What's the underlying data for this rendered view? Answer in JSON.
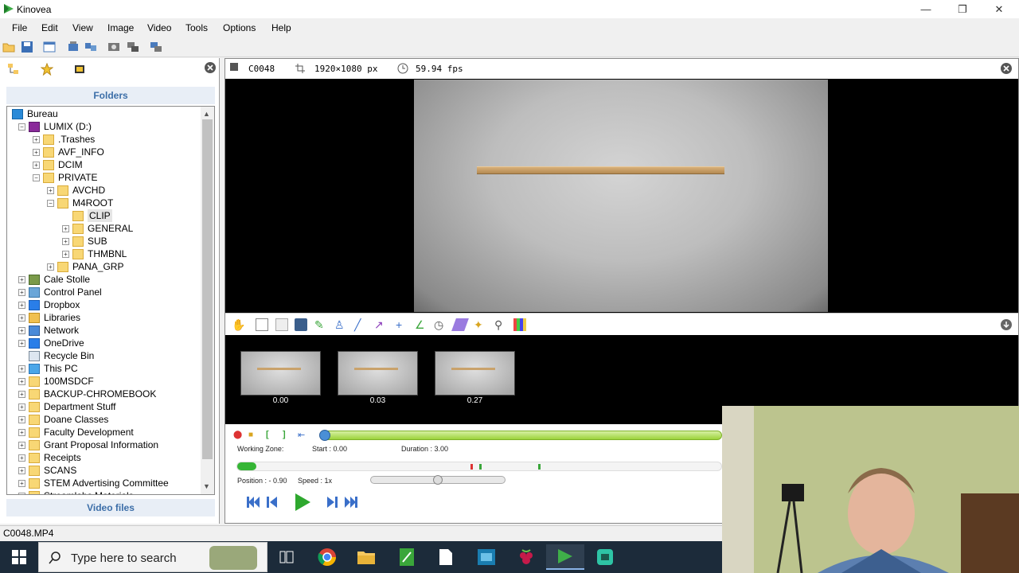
{
  "window": {
    "title": "Kinovea",
    "controls": [
      "—",
      "❐",
      "✕"
    ]
  },
  "menu": [
    "File",
    "Edit",
    "View",
    "Image",
    "Video",
    "Tools",
    "Options",
    "Help"
  ],
  "left_panel": {
    "folders_label": "Folders",
    "video_files_label": "Video files",
    "tree": [
      {
        "label": "Bureau",
        "level": 0,
        "icon": "desktop-icon",
        "exp": ""
      },
      {
        "label": "LUMIX (D:)",
        "level": 1,
        "icon": "sd-card-icon",
        "exp": "−"
      },
      {
        "label": ".Trashes",
        "level": 2,
        "icon": "folder-icon",
        "exp": "+"
      },
      {
        "label": "AVF_INFO",
        "level": 2,
        "icon": "folder-icon",
        "exp": "+"
      },
      {
        "label": "DCIM",
        "level": 2,
        "icon": "folder-icon",
        "exp": "+"
      },
      {
        "label": "PRIVATE",
        "level": 2,
        "icon": "folder-icon",
        "exp": "−"
      },
      {
        "label": "AVCHD",
        "level": 3,
        "icon": "folder-icon",
        "exp": "+"
      },
      {
        "label": "M4ROOT",
        "level": 3,
        "icon": "folder-icon",
        "exp": "−"
      },
      {
        "label": "CLIP",
        "level": 4,
        "icon": "folder-icon",
        "exp": "",
        "selected": true
      },
      {
        "label": "GENERAL",
        "level": 4,
        "icon": "folder-icon",
        "exp": "+"
      },
      {
        "label": "SUB",
        "level": 4,
        "icon": "folder-icon",
        "exp": "+"
      },
      {
        "label": "THMBNL",
        "level": 4,
        "icon": "folder-icon",
        "exp": "+"
      },
      {
        "label": "PANA_GRP",
        "level": 3,
        "icon": "folder-icon",
        "exp": "+"
      },
      {
        "label": "Cale Stolle",
        "level": 1,
        "icon": "user-icon",
        "exp": "+"
      },
      {
        "label": "Control Panel",
        "level": 1,
        "icon": "control-panel-icon",
        "exp": "+"
      },
      {
        "label": "Dropbox",
        "level": 1,
        "icon": "dropbox-icon",
        "exp": "+"
      },
      {
        "label": "Libraries",
        "level": 1,
        "icon": "library-icon",
        "exp": "+"
      },
      {
        "label": "Network",
        "level": 1,
        "icon": "network-icon",
        "exp": "+"
      },
      {
        "label": "OneDrive",
        "level": 1,
        "icon": "onedrive-icon",
        "exp": "+"
      },
      {
        "label": "Recycle Bin",
        "level": 1,
        "icon": "recycle-bin-icon",
        "exp": ""
      },
      {
        "label": "This PC",
        "level": 1,
        "icon": "computer-icon",
        "exp": "+"
      },
      {
        "label": "100MSDCF",
        "level": 1,
        "icon": "folder-icon",
        "exp": "+"
      },
      {
        "label": "BACKUP-CHROMEBOOK",
        "level": 1,
        "icon": "folder-icon",
        "exp": "+"
      },
      {
        "label": "Department Stuff",
        "level": 1,
        "icon": "folder-icon",
        "exp": "+"
      },
      {
        "label": "Doane Classes",
        "level": 1,
        "icon": "folder-icon",
        "exp": "+"
      },
      {
        "label": "Faculty Development",
        "level": 1,
        "icon": "folder-icon",
        "exp": "+"
      },
      {
        "label": "Grant Proposal Information",
        "level": 1,
        "icon": "folder-icon",
        "exp": "+"
      },
      {
        "label": "Receipts",
        "level": 1,
        "icon": "folder-icon",
        "exp": "+"
      },
      {
        "label": "SCANS",
        "level": 1,
        "icon": "folder-icon",
        "exp": "+"
      },
      {
        "label": "STEM Advertising Committee",
        "level": 1,
        "icon": "folder-icon",
        "exp": "+"
      },
      {
        "label": "Streamlabs Materials",
        "level": 1,
        "icon": "folder-icon",
        "exp": "+"
      }
    ]
  },
  "viewer": {
    "clip_name": "C0048",
    "resolution": "1920×1080 px",
    "fps": "59.94 fps",
    "keyframes": [
      {
        "time": "0.00"
      },
      {
        "time": "0.03"
      },
      {
        "time": "0.27"
      }
    ]
  },
  "player": {
    "working_zone_label": "Working Zone:",
    "start_label": "Start : 0.00",
    "duration_label": "Duration : 3.00",
    "position_label": "Position : - 0.90",
    "speed_label": "Speed : 1x",
    "navigation_position": 0.02,
    "speed_slider_value": 0.5
  },
  "status": {
    "filename": "C0048.MP4"
  },
  "taskbar": {
    "search_placeholder": "Type here to search"
  },
  "colors": {
    "accent": "#3c6ea8",
    "working_zone": "#9cd33b",
    "taskbar": "#1c2b3a"
  }
}
